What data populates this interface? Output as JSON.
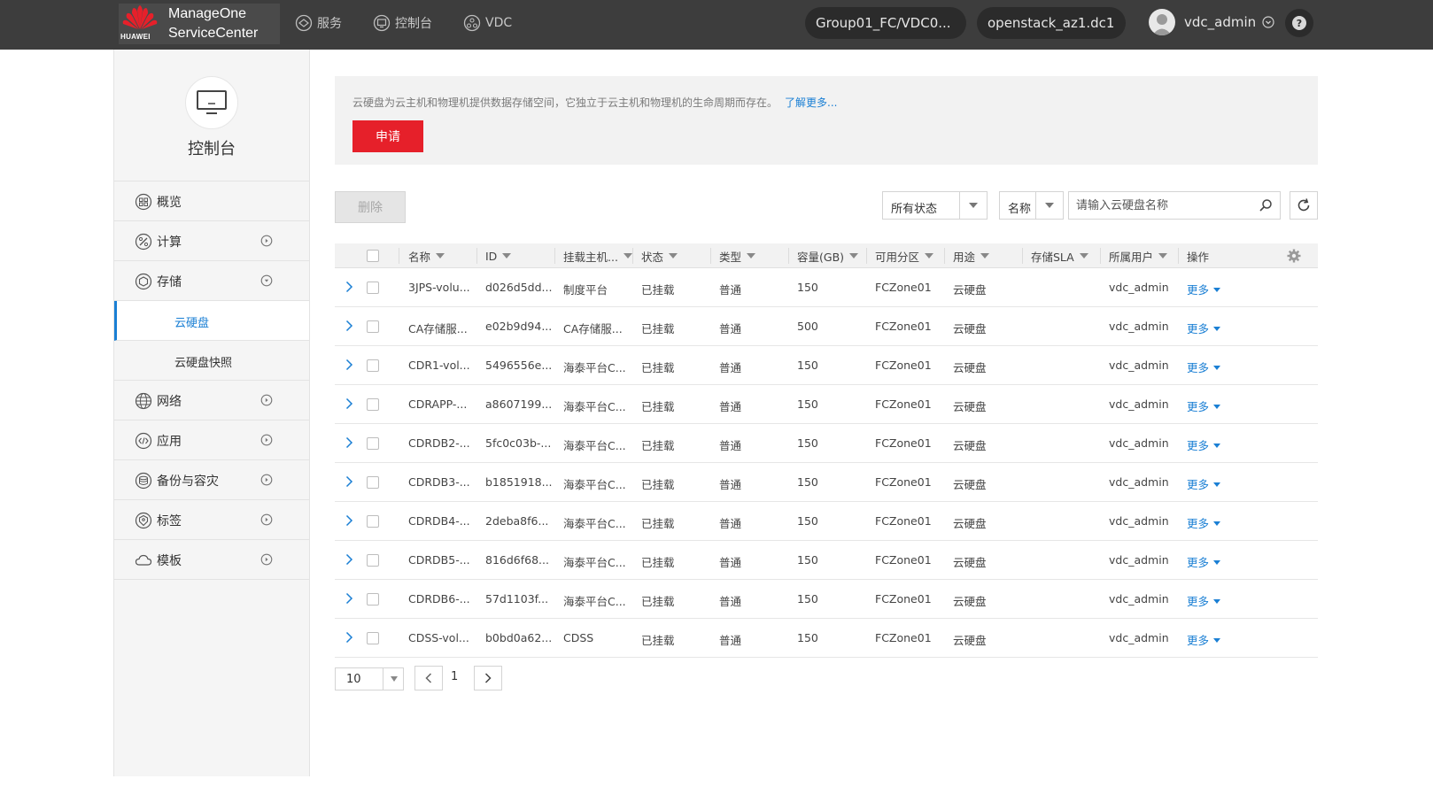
{
  "header": {
    "brand_line1": "ManageOne",
    "brand_line2": "ServiceCenter",
    "brand_logo_text": "HUAWEI",
    "nav": [
      {
        "label": "服务",
        "icon": "service-icon"
      },
      {
        "label": "控制台",
        "icon": "console-icon"
      },
      {
        "label": "VDC",
        "icon": "vdc-icon"
      }
    ],
    "project_selector": "Group01_FC/VDC0...",
    "region_selector": "openstack_az1.dc1",
    "username": "vdc_admin",
    "help_icon": "question-icon"
  },
  "sidebar": {
    "title": "控制台",
    "items": [
      {
        "label": "概览",
        "icon": "overview-icon"
      },
      {
        "label": "计算",
        "icon": "compute-icon"
      },
      {
        "label": "存储",
        "icon": "storage-icon"
      },
      {
        "label": "网络",
        "icon": "network-icon"
      },
      {
        "label": "应用",
        "icon": "application-icon"
      },
      {
        "label": "备份与容灾",
        "icon": "backup-icon"
      },
      {
        "label": "标签",
        "icon": "tag-icon"
      },
      {
        "label": "模板",
        "icon": "template-icon"
      }
    ],
    "sub_items": [
      {
        "label": "云硬盘",
        "active": true
      },
      {
        "label": "云硬盘快照",
        "active": false
      }
    ]
  },
  "banner": {
    "description": "云硬盘为云主机和物理机提供数据存储空间，它独立于云主机和物理机的生命周期而存在。",
    "learn_more": "了解更多...",
    "apply_button": "申请"
  },
  "toolbar": {
    "delete_button": "删除",
    "status_filter": "所有状态",
    "field_filter": "名称",
    "search_placeholder": "请输入云硬盘名称"
  },
  "table": {
    "columns": [
      "名称",
      "ID",
      "挂载主机...",
      "状态",
      "类型",
      "容量(GB)",
      "可用分区",
      "用途",
      "存储SLA",
      "所属用户",
      "操作"
    ],
    "rows": [
      {
        "name": "3JPS-volu...",
        "id": "d026d5dd...",
        "host": "制度平台",
        "status": "已挂载",
        "type": "普通",
        "capacity": "150",
        "zone": "FCZone01",
        "usage": "云硬盘",
        "sla": "",
        "user": "vdc_admin",
        "action": "更多"
      },
      {
        "name": "CA存储服...",
        "id": "e02b9d94...",
        "host": "CA存储服...",
        "status": "已挂载",
        "type": "普通",
        "capacity": "500",
        "zone": "FCZone01",
        "usage": "云硬盘",
        "sla": "",
        "user": "vdc_admin",
        "action": "更多"
      },
      {
        "name": "CDR1-vol...",
        "id": "5496556e...",
        "host": "海泰平台C...",
        "status": "已挂载",
        "type": "普通",
        "capacity": "150",
        "zone": "FCZone01",
        "usage": "云硬盘",
        "sla": "",
        "user": "vdc_admin",
        "action": "更多"
      },
      {
        "name": "CDRAPP-...",
        "id": "a8607199...",
        "host": "海泰平台C...",
        "status": "已挂载",
        "type": "普通",
        "capacity": "150",
        "zone": "FCZone01",
        "usage": "云硬盘",
        "sla": "",
        "user": "vdc_admin",
        "action": "更多"
      },
      {
        "name": "CDRDB2-...",
        "id": "5fc0c03b-...",
        "host": "海泰平台C...",
        "status": "已挂载",
        "type": "普通",
        "capacity": "150",
        "zone": "FCZone01",
        "usage": "云硬盘",
        "sla": "",
        "user": "vdc_admin",
        "action": "更多"
      },
      {
        "name": "CDRDB3-...",
        "id": "b1851918...",
        "host": "海泰平台C...",
        "status": "已挂载",
        "type": "普通",
        "capacity": "150",
        "zone": "FCZone01",
        "usage": "云硬盘",
        "sla": "",
        "user": "vdc_admin",
        "action": "更多"
      },
      {
        "name": "CDRDB4-...",
        "id": "2deba8f6...",
        "host": "海泰平台C...",
        "status": "已挂载",
        "type": "普通",
        "capacity": "150",
        "zone": "FCZone01",
        "usage": "云硬盘",
        "sla": "",
        "user": "vdc_admin",
        "action": "更多"
      },
      {
        "name": "CDRDB5-...",
        "id": "816d6f68...",
        "host": "海泰平台C...",
        "status": "已挂载",
        "type": "普通",
        "capacity": "150",
        "zone": "FCZone01",
        "usage": "云硬盘",
        "sla": "",
        "user": "vdc_admin",
        "action": "更多"
      },
      {
        "name": "CDRDB6-...",
        "id": "57d1103f...",
        "host": "海泰平台C...",
        "status": "已挂载",
        "type": "普通",
        "capacity": "150",
        "zone": "FCZone01",
        "usage": "云硬盘",
        "sla": "",
        "user": "vdc_admin",
        "action": "更多"
      },
      {
        "name": "CDSS-vol...",
        "id": "b0bd0a62...",
        "host": "CDSS",
        "status": "已挂载",
        "type": "普通",
        "capacity": "150",
        "zone": "FCZone01",
        "usage": "云硬盘",
        "sla": "",
        "user": "vdc_admin",
        "action": "更多"
      }
    ]
  },
  "pagination": {
    "page_size": "10",
    "current_page": "1"
  },
  "colors": {
    "topbar": "#3d3d3d",
    "accent_red": "#e6202a",
    "link_blue": "#1a7fd4"
  }
}
